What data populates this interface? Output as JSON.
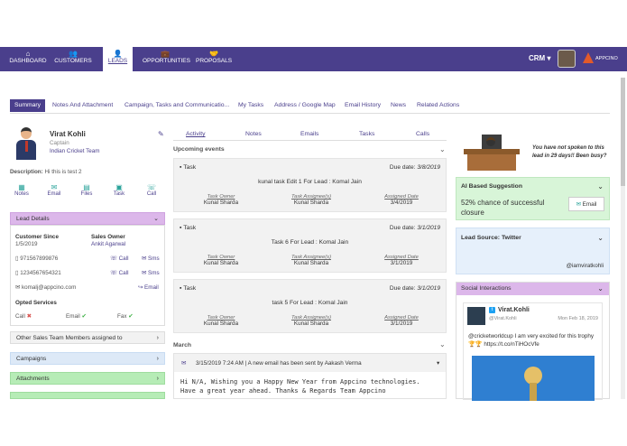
{
  "nav": [
    {
      "label": "DASHBOARD",
      "icon": "home-icon",
      "glyph": "⌂"
    },
    {
      "label": "CUSTOMERS",
      "icon": "users-icon",
      "glyph": "👥"
    },
    {
      "label": "LEADS",
      "icon": "lead-icon",
      "glyph": "👤"
    },
    {
      "label": "OPPORTUNITIES",
      "icon": "briefcase-icon",
      "glyph": "💼"
    },
    {
      "label": "PROPOSALS",
      "icon": "handshake-icon",
      "glyph": "🤝"
    }
  ],
  "header": {
    "crm": "CRM ▾",
    "brand": "APPCINO"
  },
  "tabs": [
    "Summary",
    "Notes And Attachment",
    "Campaign, Tasks and Communicatio...",
    "My Tasks",
    "Address / Google Map",
    "Email History",
    "News",
    "Related Actions"
  ],
  "profile": {
    "name": "Virat Kohli",
    "title": "Captain",
    "company": "Indian Cricket Team",
    "description_label": "Description:",
    "description": "Hi this is test 2"
  },
  "quick_actions": [
    "Notes",
    "Email",
    "Files",
    "Task",
    "Call"
  ],
  "lead_details": {
    "title": "Lead Details",
    "customer_since_label": "Customer Since",
    "customer_since": "1/5/2019",
    "sales_owner_label": "Sales Owner",
    "sales_owner": "Ankit Agarwal",
    "phone1": "971567899876",
    "phone2": "1234567654321",
    "email": "komalj@appcino.com",
    "call": "Call",
    "sms": "Sms",
    "email_action": "Email",
    "opted_label": "Opted Services",
    "opted": [
      {
        "label": "Call",
        "mark": "✖",
        "color": "#d9534f"
      },
      {
        "label": "Email",
        "mark": "✔",
        "color": "#3cb043"
      },
      {
        "label": "Fax",
        "mark": "✔",
        "color": "#3cb043"
      }
    ]
  },
  "sections": {
    "team": "Other Sales Team Members assigned to",
    "campaigns": "Campaigns",
    "attachments": "Attachments"
  },
  "activity_tabs": [
    "Activity",
    "Notes",
    "Emails",
    "Tasks",
    "Calls"
  ],
  "upcoming": "Upcoming events",
  "tasks": [
    {
      "type": "Task",
      "due_label": "Due date:",
      "due": "3/8/2019",
      "title": "kunal task Edit 1 For Lead : Komal Jain",
      "owner": "Kunal Sharda",
      "assignee": "Kunal Sharda",
      "assigned": "3/4/2019"
    },
    {
      "type": "Task",
      "due_label": "Due date:",
      "due": "3/1/2019",
      "title": "Task 6 For Lead : Komal Jain",
      "owner": "Kunal Sharda",
      "assignee": "Kunal Sharda",
      "assigned": "3/1/2019"
    },
    {
      "type": "Task",
      "due_label": "Due date:",
      "due": "3/1/2019",
      "title": "task 5 For Lead : Komal Jain",
      "owner": "Kunal Sharda",
      "assignee": "Kunal Sharda",
      "assigned": "3/1/2019"
    }
  ],
  "task_cols": {
    "owner": "Task Owner",
    "assignee": "Task Assignee(s)",
    "assigned": "Assigned Date"
  },
  "march": {
    "label": "March",
    "email_head": "3/15/2019 7:24 AM | A new email has been sent by Aakash Verma",
    "email_body": "Hi N/A, Wishing you a Happy New Year from Appcino technologies. Have a great year ahead. Thanks & Regards Team Appcino"
  },
  "right": {
    "busy": "You have not spoken to this lead in 29 days!! Been busy?",
    "ai_title": "AI Based Suggestion",
    "ai_text": "52% chance of successful closure",
    "ai_button": "Email",
    "source": "Lead Source: Twitter",
    "handle": "@iamviratkohli",
    "social": "Social Interactions",
    "tweet_name": "Virat.Kohli",
    "tweet_user": "@Virat.Kohli",
    "tweet_date": "Mon Feb 18, 2019",
    "tweet_text": "@cricketworldcup I am very excited for this trophy 🏆🏆 https://t.co/nTiHOcVfe"
  }
}
